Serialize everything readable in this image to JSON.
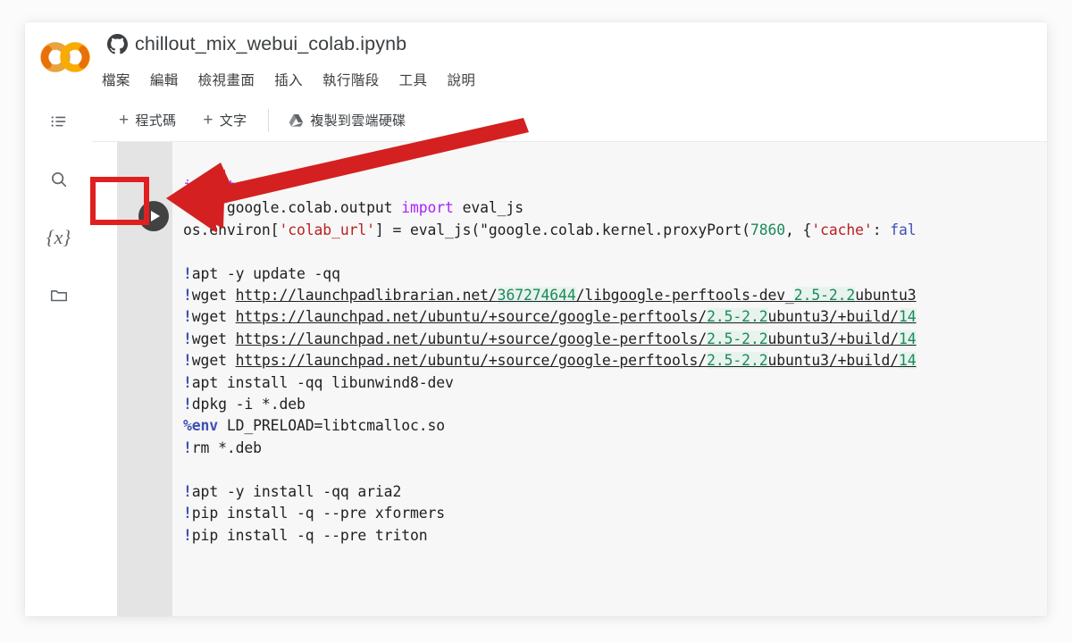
{
  "window": {
    "background_color": "#fbfbfb",
    "card_background": "#ffffff"
  },
  "header": {
    "logo_name": "colab-logo",
    "source_icon": "github-icon",
    "title": "chillout_mix_webui_colab.ipynb"
  },
  "menubar": {
    "items": [
      {
        "label": "檔案"
      },
      {
        "label": "編輯"
      },
      {
        "label": "檢視畫面"
      },
      {
        "label": "插入"
      },
      {
        "label": "執行階段"
      },
      {
        "label": "工具"
      },
      {
        "label": "說明"
      }
    ]
  },
  "toolbar": {
    "add_code_plus": "+",
    "add_code_label": "程式碼",
    "add_text_plus": "+",
    "add_text_label": "文字",
    "copy_to_drive_label": "複製到雲端硬碟",
    "drive_icon": "google-drive-icon"
  },
  "sidebar": {
    "items": [
      {
        "icon": "table-of-contents-icon",
        "name": "toc"
      },
      {
        "icon": "search-icon",
        "name": "search"
      },
      {
        "icon": "variables-icon",
        "label": "{x}",
        "name": "variables"
      },
      {
        "icon": "folder-icon",
        "name": "files"
      }
    ]
  },
  "cell": {
    "run_button_icon": "play-icon",
    "highlight_color": "#e02020",
    "annotation": {
      "arrow_color": "#d42020",
      "arrow_points_to": "run-cell-button"
    },
    "ruler_column": 80,
    "code_lines": [
      "import os",
      "from google.colab.output import eval_js",
      "os.environ['colab_url'] = eval_js(\"google.colab.kernel.proxyPort(7860, {'cache': fal",
      "",
      "!apt -y update -qq",
      "!wget http://launchpadlibrarian.net/367274644/libgoogle-perftools-dev_2.5-2.2ubuntu3",
      "!wget https://launchpad.net/ubuntu/+source/google-perftools/2.5-2.2ubuntu3/+build/14",
      "!wget https://launchpad.net/ubuntu/+source/google-perftools/2.5-2.2ubuntu3/+build/14",
      "!wget https://launchpad.net/ubuntu/+source/google-perftools/2.5-2.2ubuntu3/+build/14",
      "!apt install -qq libunwind8-dev",
      "!dpkg -i *.deb",
      "%env LD_PRELOAD=libtcmalloc.so",
      "!rm *.deb",
      "",
      "!apt -y install -qq aria2",
      "!pip install -q --pre xformers",
      "!pip install -q --pre triton"
    ]
  },
  "code_tokens": {
    "l1_kw": "import",
    "l1_rest": " os",
    "l2_kw_from": "from",
    "l2_mid": " google.colab.output ",
    "l2_kw_import": "import",
    "l2_rest": " eval_js",
    "l3_a": "os.environ[",
    "l3_str1": "'colab_url'",
    "l3_b": "] = eval_js(",
    "l3_str2": "\"google.colab.kernel.proxyPort(",
    "l3_num": "7860",
    "l3_c": ", {",
    "l3_str3": "'cache'",
    "l3_d": ": ",
    "l3_bool": "fal",
    "bang": "!",
    "l5": "apt -y update -qq",
    "l6_cmd": "wget ",
    "l6_url_a": "http://launchpadlibrarian.net/",
    "l6_url_num": "367274644",
    "l6_url_b": "/libgoogle-perftools-dev_",
    "l6_ver": "2.5-2.2",
    "l6_url_c": "ubuntu3",
    "l7_url_a": "https://launchpad.net/ubuntu/+source/google-perftools/",
    "l7_ver": "2.5-2.2",
    "l7_url_b": "ubuntu3/+build/",
    "l7_num": "14",
    "l10": "apt install -qq libunwind8-dev",
    "l11": "dpkg -i *.deb",
    "l12_magic": "%env",
    "l12_rest": " LD_PRELOAD=libtcmalloc.so",
    "l13": "rm *.deb",
    "l15": "apt -y install -qq aria2",
    "l16": "pip install -q --pre xformers",
    "l17": "pip install -q --pre triton"
  }
}
